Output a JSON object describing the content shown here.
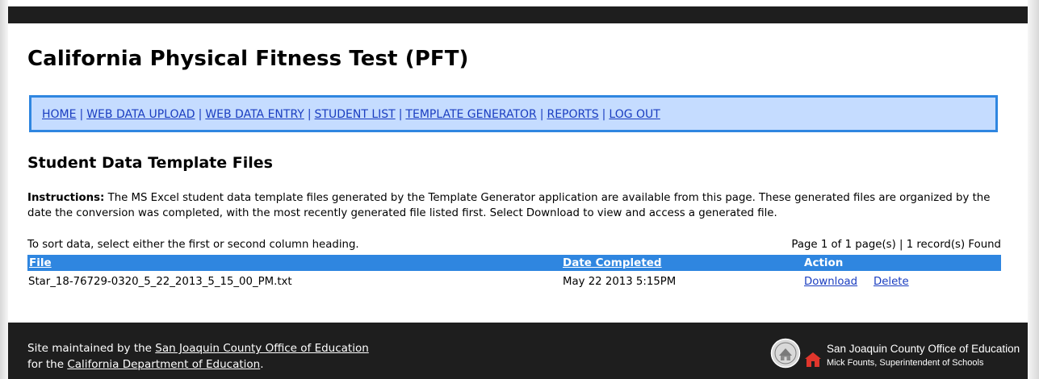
{
  "page": {
    "title": "California Physical Fitness Test (PFT)"
  },
  "nav": {
    "items": [
      {
        "label": "HOME"
      },
      {
        "label": "WEB DATA UPLOAD"
      },
      {
        "label": "WEB DATA ENTRY"
      },
      {
        "label": "STUDENT LIST"
      },
      {
        "label": "TEMPLATE GENERATOR"
      },
      {
        "label": "REPORTS"
      },
      {
        "label": "LOG OUT"
      }
    ],
    "separator": "|"
  },
  "section": {
    "title": "Student Data Template Files",
    "instructions_label": "Instructions:",
    "instructions_text": "The MS Excel student data template files generated by the Template Generator application are available from this page. These generated files are organized by the date the conversion was completed, with the most recently generated file listed first. Select Download to view and access a generated file."
  },
  "grid": {
    "sort_hint": "To sort data, select either the first or second column heading.",
    "page_info": "Page 1 of 1 page(s) | 1 record(s) Found",
    "columns": {
      "file": "File",
      "date_completed": "Date Completed",
      "action": "Action"
    },
    "rows": [
      {
        "file": "Star_18-76729-0320_5_22_2013_5_15_00_PM.txt",
        "date_completed": "May 22 2013 5:15PM",
        "download": "Download",
        "delete": "Delete"
      }
    ]
  },
  "footer": {
    "maintained_prefix": "Site maintained by the",
    "maintained_link": "San Joaquin County Office of Education",
    "for_prefix": "for the",
    "for_link": "California Department of Education",
    "for_suffix": ".",
    "logo_line1": "San Joaquin County Office of Education",
    "logo_line2": "Mick Founts, Superintendent of Schools"
  },
  "colors": {
    "nav_background": "#c5dcff",
    "accent_blue": "#2f86e0",
    "link_blue": "#1a3dc0",
    "dark_bar": "#1e1e1e"
  }
}
